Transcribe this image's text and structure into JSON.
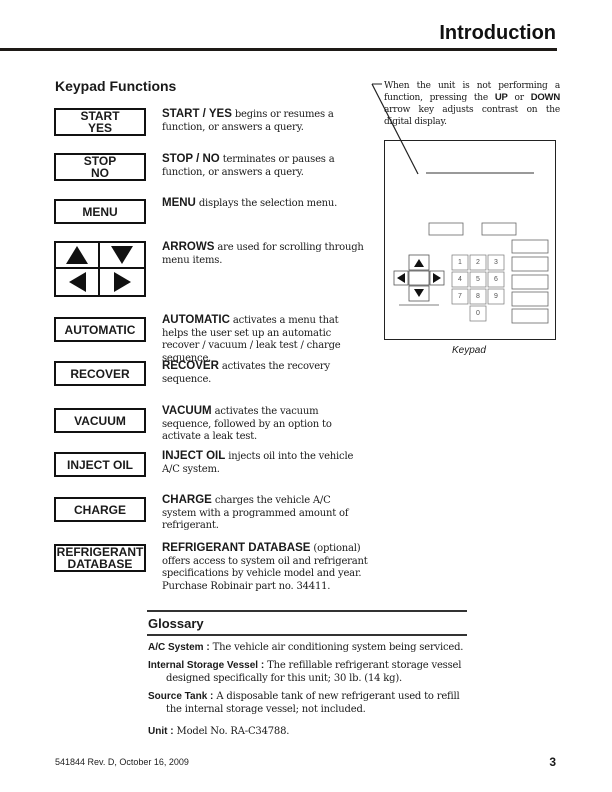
{
  "header": {
    "title": "Introduction"
  },
  "keypad_functions": {
    "title": "Keypad Functions",
    "items": [
      {
        "key_lines": [
          "START",
          "YES"
        ],
        "term": "START / YES",
        "desc": " begins or resumes a function, or answers a query."
      },
      {
        "key_lines": [
          "STOP",
          "NO"
        ],
        "term": "STOP / NO",
        "desc": " terminates or pauses a function, or answers a query."
      },
      {
        "key_lines": [
          "MENU"
        ],
        "term": "MENU",
        "desc": " displays the selection menu."
      },
      {
        "key_lines": [],
        "icon": "arrow-keys",
        "term": "ARROWS",
        "desc": " are used for scrolling through menu items."
      },
      {
        "key_lines": [
          "AUTOMATIC"
        ],
        "term": "AUTOMATIC",
        "desc": " activates a menu that helps the user set up an automatic recover / vacuum / leak test / charge sequence."
      },
      {
        "key_lines": [
          "RECOVER"
        ],
        "term": "RECOVER",
        "desc": " activates the recovery sequence."
      },
      {
        "key_lines": [
          "VACUUM"
        ],
        "term": "VACUUM",
        "desc": " activates the vacuum sequence, followed by an option to activate a leak test."
      },
      {
        "key_lines": [
          "INJECT OIL"
        ],
        "term": "INJECT OIL",
        "desc": " injects oil into the vehicle A/C system."
      },
      {
        "key_lines": [
          "CHARGE"
        ],
        "term": "CHARGE",
        "desc": " charges the vehicle A/C system with a programmed amount of refrigerant."
      },
      {
        "key_lines": [
          "REFRIGERANT",
          "DATABASE"
        ],
        "term": "REFRIGERANT DATABASE",
        "desc_suffix": " (optional)",
        "desc": " offers access to system oil and refrigerant specifications by vehicle model and year. Purchase Robinair part no. 34411."
      }
    ]
  },
  "callout": {
    "pre": "When the unit is not performing a function, pressing the ",
    "up": "UP",
    "mid": " or ",
    "down": "DOWN",
    "post": " arrow key adjusts contrast on the digital display."
  },
  "figure": {
    "caption": "Keypad",
    "digits": [
      "1",
      "2",
      "3",
      "4",
      "5",
      "6",
      "7",
      "8",
      "9",
      "0"
    ]
  },
  "glossary": {
    "title": "Glossary",
    "entries": [
      {
        "term": "A/C System :",
        "line1": " The vehicle air conditioning system being serviced.",
        "line2": ""
      },
      {
        "term": "Internal Storage Vessel :",
        "line1": " The refillable refrigerant storage vessel",
        "line2": "designed specifically for this unit; 30 lb. (14 kg)."
      },
      {
        "term": "Source Tank :",
        "line1": " A disposable tank of new refrigerant used to refill",
        "line2": "the internal storage vessel; not included."
      },
      {
        "term": "Unit :",
        "line1": " Model No. RA-C34788.",
        "line2": ""
      }
    ]
  },
  "footer": {
    "doc_info": "541844  Rev. D, October 16, 2009",
    "page_number": "3"
  }
}
